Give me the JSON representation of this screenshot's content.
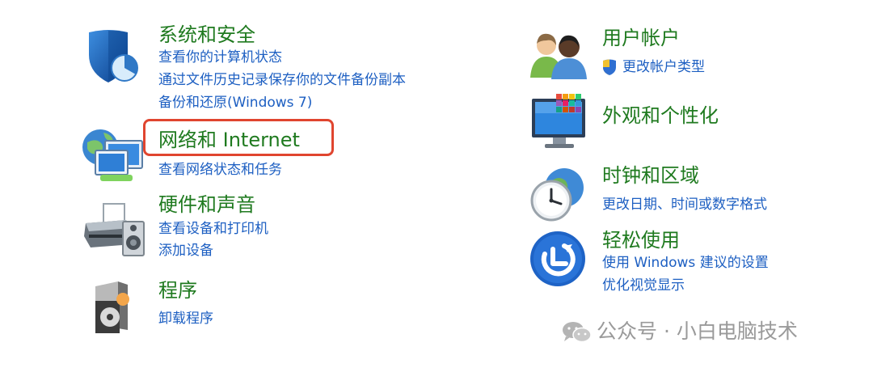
{
  "left": {
    "system": {
      "title": "系统和安全",
      "links": [
        "查看你的计算机状态",
        "通过文件历史记录保存你的文件备份副本",
        "备份和还原(Windows 7)"
      ]
    },
    "network": {
      "title": "网络和 Internet",
      "links": [
        "查看网络状态和任务"
      ]
    },
    "hardware": {
      "title": "硬件和声音",
      "links": [
        "查看设备和打印机",
        "添加设备"
      ]
    },
    "programs": {
      "title": "程序",
      "links": [
        "卸载程序"
      ]
    }
  },
  "right": {
    "accounts": {
      "title": "用户帐户",
      "links": [
        "更改帐户类型"
      ]
    },
    "appearance": {
      "title": "外观和个性化"
    },
    "clock": {
      "title": "时钟和区域",
      "links": [
        "更改日期、时间或数字格式"
      ]
    },
    "ease": {
      "title": "轻松使用",
      "links": [
        "使用 Windows 建议的设置",
        "优化视觉显示"
      ]
    }
  },
  "watermark": {
    "text": "公众号 · 小白电脑技术"
  },
  "colors": {
    "title": "#1f7a1f",
    "link": "#1d5fc2",
    "highlight": "#e0452f"
  }
}
